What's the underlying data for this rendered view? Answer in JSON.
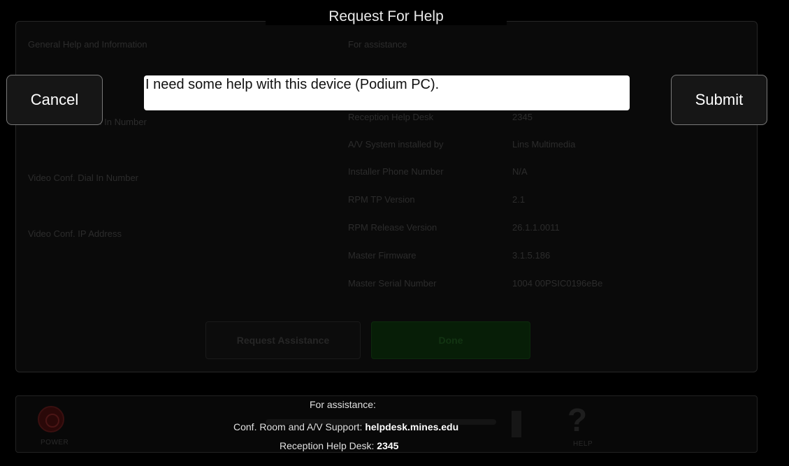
{
  "modal": {
    "title": "Request For Help",
    "cancel_label": "Cancel",
    "submit_label": "Submit",
    "message_value": "I need some help with this device (Podium PC)."
  },
  "background": {
    "left_heading": "General Help and Information",
    "right_heading": "For assistance",
    "left_items": [
      "Conference Room In Number",
      "Video Conf. Dial In Number",
      "Video Conf. IP Address"
    ],
    "info_rows": [
      {
        "label": "Reception Help Desk",
        "value": "2345"
      },
      {
        "label": "A/V System installed by",
        "value": "Lins Multimedia"
      },
      {
        "label": "Installer Phone Number",
        "value": "N/A"
      },
      {
        "label": "RPM TP Version",
        "value": "2.1"
      },
      {
        "label": "RPM Release Version",
        "value": "26.1.1.0011"
      },
      {
        "label": "Master Firmware",
        "value": "3.1.5.186"
      },
      {
        "label": "Master Serial Number",
        "value": "1004 00PSIC0196eBe"
      }
    ],
    "request_button": "Request Assistance",
    "done_button": "Done"
  },
  "footer": {
    "power_label": "POWER",
    "help_label": "HELP",
    "help_icon": "?"
  },
  "assistance": {
    "heading": "For assistance:",
    "av_label": "Conf. Room and A/V Support:",
    "av_value": "helpdesk.mines.edu",
    "reception_label": "Reception Help Desk:",
    "reception_value": "2345"
  },
  "colors": {
    "background": "#000000",
    "input_bg": "#ffffff",
    "done_green": "#071e07",
    "power_red": "#2a0808"
  }
}
